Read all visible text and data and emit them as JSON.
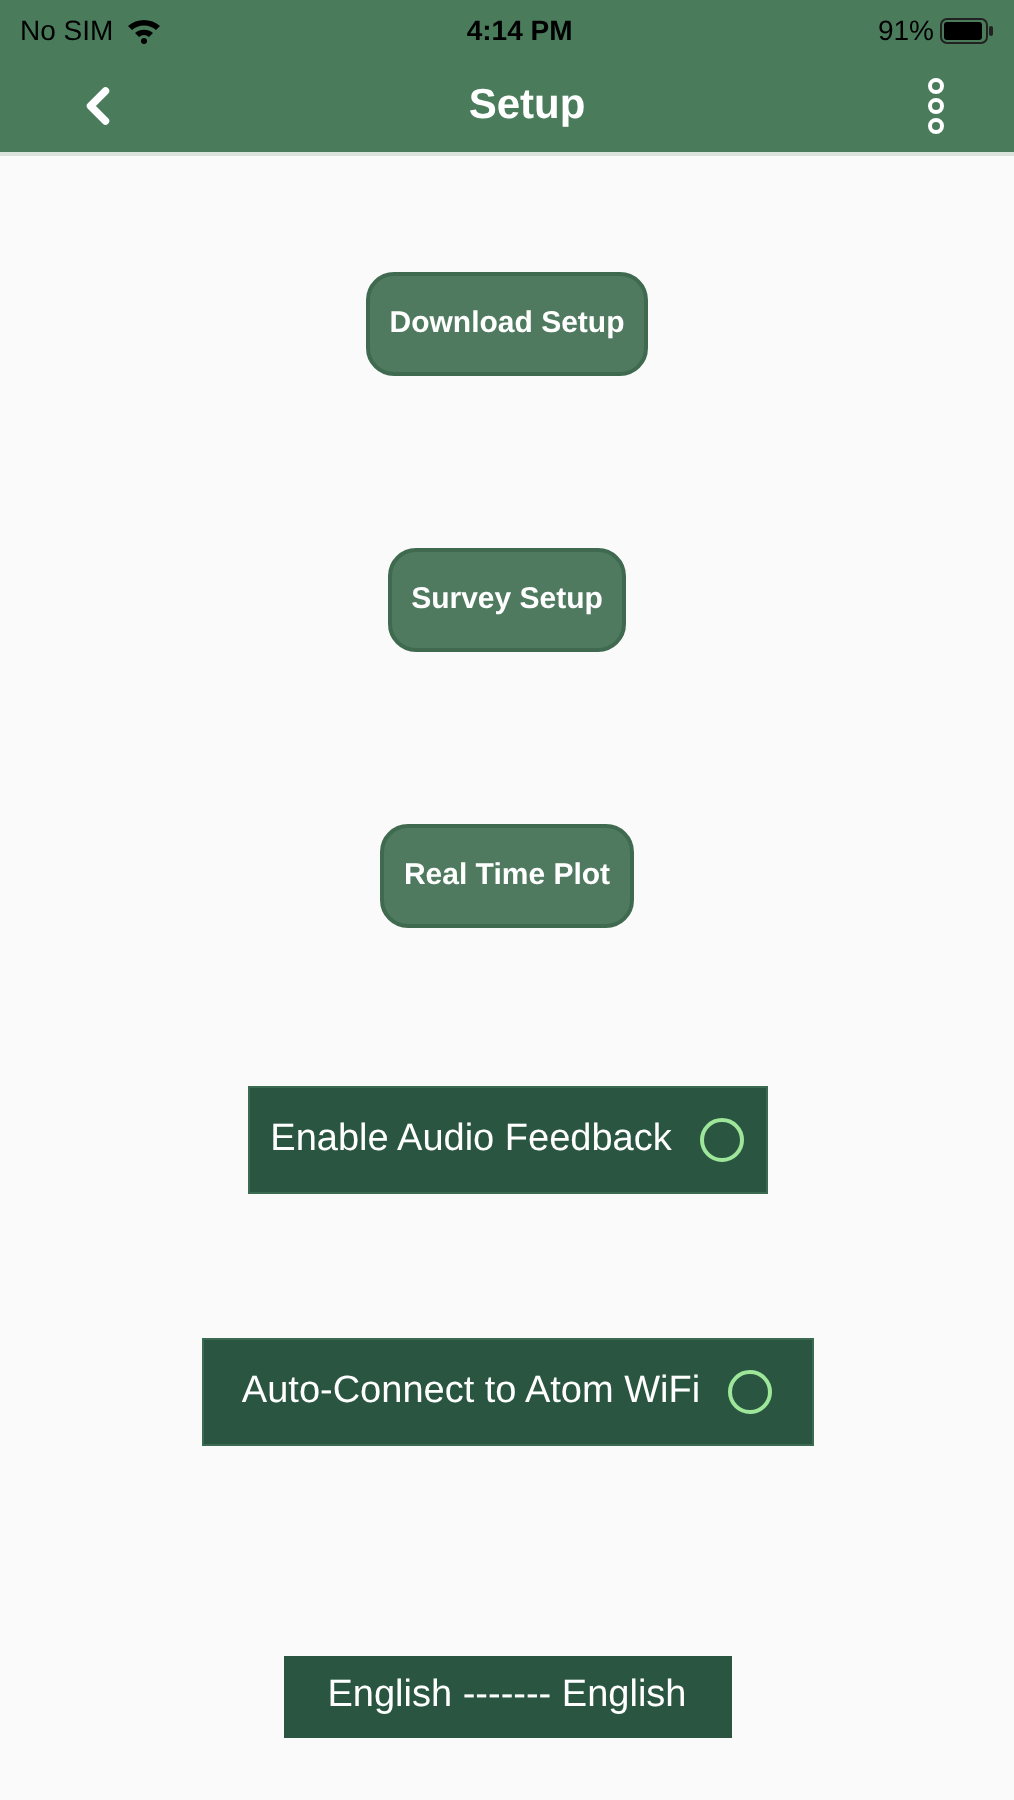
{
  "status_bar": {
    "carrier": "No SIM",
    "time": "4:14 PM",
    "battery": "91%"
  },
  "nav": {
    "title": "Setup"
  },
  "buttons": [
    "Download Setup",
    "Survey Setup",
    "Real Time Plot"
  ],
  "toggles": [
    {
      "label": "Enable Audio Feedback",
      "checked": false
    },
    {
      "label": "Auto-Connect to Atom WiFi",
      "checked": false
    }
  ],
  "language": {
    "label": "English ------- English"
  }
}
